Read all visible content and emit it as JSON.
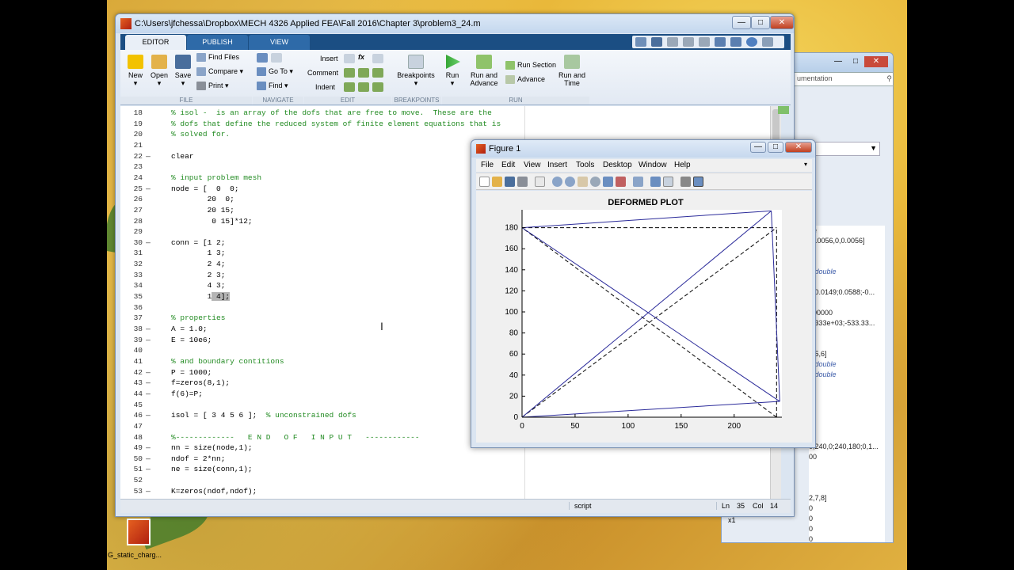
{
  "editor": {
    "title": "C:\\Users\\jfchessa\\Dropbox\\MECH 4326 Applied FEA\\Fall 2016\\Chapter 3\\problem3_24.m",
    "tabs": [
      "EDITOR",
      "PUBLISH",
      "VIEW"
    ],
    "ribbon": {
      "new": "New",
      "open": "Open",
      "save": "Save",
      "find_files": "Find Files",
      "compare": "Compare",
      "print": "Print",
      "go_to": "Go To",
      "find": "Find",
      "insert": "Insert",
      "comment": "Comment",
      "indent": "Indent",
      "breakpoints": "Breakpoints",
      "run": "Run",
      "run_and_advance_1": "Run and",
      "run_and_advance_2": "Advance",
      "run_section": "Run Section",
      "advance": "Advance",
      "run_and_time_1": "Run and",
      "run_and_time_2": "Time",
      "sections": [
        "FILE",
        "NAVIGATE",
        "EDIT",
        "BREAKPOINTS",
        "RUN"
      ]
    },
    "code_lines": [
      {
        "n": "18",
        "d": "",
        "t": "% isol -  is an array of the dofs that are free to move.  These are the",
        "c": "cm"
      },
      {
        "n": "19",
        "d": "",
        "t": "% dofs that define the reduced system of finite element equations that is",
        "c": "cm"
      },
      {
        "n": "20",
        "d": "",
        "t": "% solved for.",
        "c": "cm"
      },
      {
        "n": "21",
        "d": "",
        "t": "",
        "c": ""
      },
      {
        "n": "22",
        "d": "—",
        "t": "clear",
        "c": ""
      },
      {
        "n": "23",
        "d": "",
        "t": "",
        "c": ""
      },
      {
        "n": "24",
        "d": "",
        "t": "% input problem mesh",
        "c": "cm"
      },
      {
        "n": "25",
        "d": "—",
        "t": "node = [  0  0;",
        "c": ""
      },
      {
        "n": "26",
        "d": "",
        "t": "        20  0;",
        "c": ""
      },
      {
        "n": "27",
        "d": "",
        "t": "        20 15;",
        "c": ""
      },
      {
        "n": "28",
        "d": "",
        "t": "         0 15]*12;",
        "c": ""
      },
      {
        "n": "29",
        "d": "",
        "t": "",
        "c": ""
      },
      {
        "n": "30",
        "d": "—",
        "t": "conn = [1 2;",
        "c": ""
      },
      {
        "n": "31",
        "d": "",
        "t": "        1 3;",
        "c": ""
      },
      {
        "n": "32",
        "d": "",
        "t": "        2 4;",
        "c": ""
      },
      {
        "n": "33",
        "d": "",
        "t": "        2 3;",
        "c": ""
      },
      {
        "n": "34",
        "d": "",
        "t": "        4 3;",
        "c": ""
      },
      {
        "n": "35",
        "d": "",
        "t": "        1 4];",
        "c": "",
        "hl": true
      },
      {
        "n": "36",
        "d": "",
        "t": "",
        "c": ""
      },
      {
        "n": "37",
        "d": "",
        "t": "% properties",
        "c": "cm"
      },
      {
        "n": "38",
        "d": "—",
        "t": "A = 1.0;",
        "c": ""
      },
      {
        "n": "39",
        "d": "—",
        "t": "E = 10e6;",
        "c": ""
      },
      {
        "n": "40",
        "d": "",
        "t": "",
        "c": ""
      },
      {
        "n": "41",
        "d": "",
        "t": "% and boundary contitions",
        "c": "cm"
      },
      {
        "n": "42",
        "d": "—",
        "t": "P = 1000;",
        "c": ""
      },
      {
        "n": "43",
        "d": "—",
        "t": "f=zeros(8,1);",
        "c": ""
      },
      {
        "n": "44",
        "d": "—",
        "t": "f(6)=P;",
        "c": ""
      },
      {
        "n": "45",
        "d": "",
        "t": "",
        "c": ""
      },
      {
        "n": "46",
        "d": "—",
        "t": "isol = [ 3 4 5 6 ];  % unconstrained dofs",
        "c": "mix"
      },
      {
        "n": "47",
        "d": "",
        "t": "",
        "c": ""
      },
      {
        "n": "48",
        "d": "",
        "t": "%-------------   E N D   O F   I N P U T   ------------",
        "c": "cm"
      },
      {
        "n": "49",
        "d": "—",
        "t": "nn = size(node,1);",
        "c": ""
      },
      {
        "n": "50",
        "d": "—",
        "t": "ndof = 2*nn;",
        "c": ""
      },
      {
        "n": "51",
        "d": "—",
        "t": "ne = size(conn,1);",
        "c": ""
      },
      {
        "n": "52",
        "d": "",
        "t": "",
        "c": ""
      },
      {
        "n": "53",
        "d": "—",
        "t": "K=zeros(ndof,ndof);",
        "c": ""
      }
    ],
    "status": {
      "mode": "script",
      "ln_label": "Ln",
      "ln": "35",
      "col_label": "Col",
      "col": "14"
    }
  },
  "figure": {
    "title": "Figure 1",
    "menu": [
      "File",
      "Edit",
      "View",
      "Insert",
      "Tools",
      "Desktop",
      "Window",
      "Help"
    ]
  },
  "chart_data": {
    "type": "line",
    "title": "DEFORMED PLOT",
    "xlabel": "",
    "ylabel": "",
    "xlim": [
      0,
      245
    ],
    "ylim": [
      0,
      197
    ],
    "xticks": [
      0,
      50,
      100,
      150,
      200
    ],
    "yticks": [
      0,
      20,
      40,
      60,
      80,
      100,
      120,
      140,
      160,
      180
    ],
    "series": [
      {
        "style": "dashed",
        "color": "#000000",
        "segments": [
          [
            [
              0,
              0
            ],
            [
              240,
              0
            ]
          ],
          [
            [
              0,
              0
            ],
            [
              240,
              180
            ]
          ],
          [
            [
              240,
              0
            ],
            [
              0,
              180
            ]
          ],
          [
            [
              240,
              0
            ],
            [
              240,
              180
            ]
          ],
          [
            [
              0,
              180
            ],
            [
              240,
              180
            ]
          ],
          [
            [
              0,
              0
            ],
            [
              0,
              180
            ]
          ]
        ]
      },
      {
        "style": "solid",
        "color": "#2b2b9a",
        "segments": [
          [
            [
              0,
              0
            ],
            [
              243,
              15
            ]
          ],
          [
            [
              0,
              0
            ],
            [
              235,
              196
            ]
          ],
          [
            [
              243,
              15
            ],
            [
              0,
              180
            ]
          ],
          [
            [
              243,
              15
            ],
            [
              235,
              196
            ]
          ],
          [
            [
              0,
              180
            ],
            [
              235,
              196
            ]
          ],
          [
            [
              0,
              0
            ],
            [
              0,
              180
            ]
          ]
        ]
      }
    ]
  },
  "background_window": {
    "search_text": "umentation",
    "workspace_values": [
      "ue",
      "-0.0056,0,0.0056]",
      "",
      "",
      "8 double",
      "",
      "0;0.0149;0.0588;-0...",
      "",
      "000000",
      ".3333e+03;-533.33...",
      "",
      "",
      "4,5,6]",
      "8 double",
      "8 double",
      "0",
      "",
      "",
      "",
      "",
      "",
      "0;240,0;240,180;0,1...",
      "00",
      "",
      "",
      "",
      "2,7,8]",
      "0",
      "0",
      "0",
      "0",
      "0",
      "0",
      "0"
    ],
    "x1_label": "x1"
  },
  "desktop": {
    "icon_label": "G_static_charg..."
  }
}
